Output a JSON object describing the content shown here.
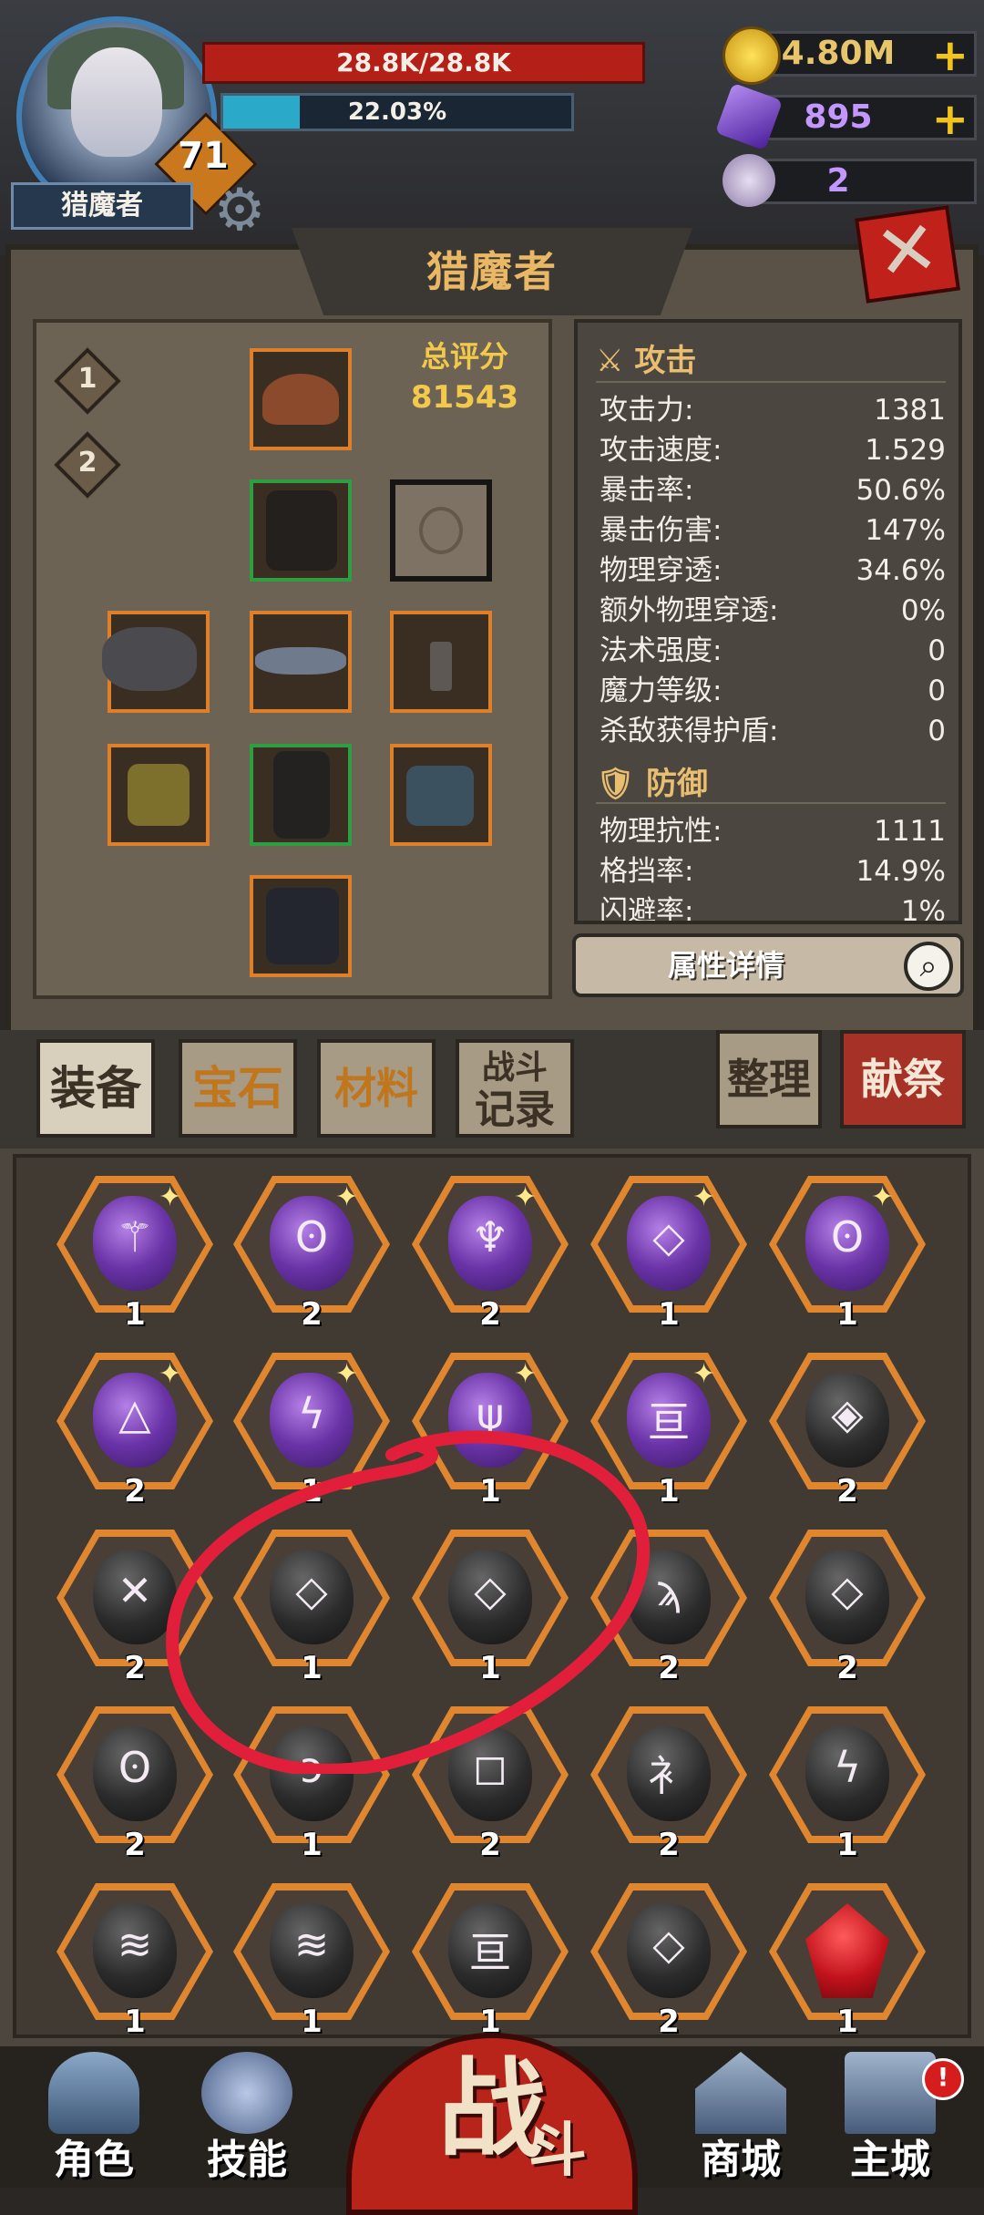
{
  "player": {
    "name": "猎魔者",
    "level": "71",
    "hp_text": "28.8K/28.8K",
    "xp_text": "22.03%",
    "xp_progress": 0.2203
  },
  "currencies": [
    {
      "icon": "gold-coin-icon",
      "value": "4.80M",
      "has_plus": true
    },
    {
      "icon": "purple-crystal-icon",
      "value": "895",
      "has_plus": true
    },
    {
      "icon": "ram-skull-icon",
      "value": "2",
      "has_plus": false
    }
  ],
  "panel": {
    "title": "猎魔者",
    "loadout_tabs": [
      "1",
      "2"
    ],
    "score_label": "总评分",
    "score_value": "81543"
  },
  "stats": {
    "attack_header": "攻击",
    "attack": [
      {
        "label": "攻击力:",
        "value": "1381"
      },
      {
        "label": "攻击速度:",
        "value": "1.529"
      },
      {
        "label": "暴击率:",
        "value": "50.6%"
      },
      {
        "label": "暴击伤害:",
        "value": "147%"
      },
      {
        "label": "物理穿透:",
        "value": "34.6%"
      },
      {
        "label": "额外物理穿透:",
        "value": "0%"
      },
      {
        "label": "法术强度:",
        "value": "0"
      },
      {
        "label": "魔力等级:",
        "value": "0"
      },
      {
        "label": "杀敌获得护盾:",
        "value": "0"
      }
    ],
    "defense_header": "防御",
    "defense": [
      {
        "label": "物理抗性:",
        "value": "1111"
      },
      {
        "label": "格挡率:",
        "value": "14.9%"
      },
      {
        "label": "闪避率:",
        "value": "1%"
      }
    ],
    "detail_button": "属性详情"
  },
  "tabs": {
    "equipment": "装备",
    "gems": "宝石",
    "materials": "材料",
    "battle_log_1": "战斗",
    "battle_log_2": "记录",
    "sort": "整理",
    "sacrifice": "献祭"
  },
  "colors": {
    "rarity_orange": "#e07f2a",
    "rarity_green": "#2e9f41",
    "hp_red": "#b41f18",
    "xp_cyan": "#2ba9c9",
    "gold_text": "#f3c94c"
  },
  "inventory": [
    {
      "type": "purple",
      "glyph": "⚚",
      "count": "1"
    },
    {
      "type": "purple",
      "glyph": "ʘ",
      "count": "2"
    },
    {
      "type": "purple",
      "glyph": "♆",
      "count": "2"
    },
    {
      "type": "purple",
      "glyph": "◇",
      "count": "1"
    },
    {
      "type": "purple",
      "glyph": "ʘ",
      "count": "1"
    },
    {
      "type": "purple",
      "glyph": "△",
      "count": "2"
    },
    {
      "type": "purple",
      "glyph": "ϟ",
      "count": "1"
    },
    {
      "type": "purple",
      "glyph": "ψ",
      "count": "1"
    },
    {
      "type": "purple",
      "glyph": "亘",
      "count": "1"
    },
    {
      "type": "black",
      "glyph": "◈",
      "count": "2"
    },
    {
      "type": "black",
      "glyph": "✕",
      "count": "2"
    },
    {
      "type": "black",
      "glyph": "◇",
      "count": "1"
    },
    {
      "type": "black",
      "glyph": "◇",
      "count": "1"
    },
    {
      "type": "black",
      "glyph": "ϡ",
      "count": "2"
    },
    {
      "type": "black",
      "glyph": "◇",
      "count": "2"
    },
    {
      "type": "black",
      "glyph": "ʘ",
      "count": "2"
    },
    {
      "type": "black",
      "glyph": "ᴐ",
      "count": "1"
    },
    {
      "type": "black",
      "glyph": "◻",
      "count": "2"
    },
    {
      "type": "black",
      "glyph": "衤",
      "count": "2"
    },
    {
      "type": "black",
      "glyph": "ϟ",
      "count": "1"
    },
    {
      "type": "black",
      "glyph": "≋",
      "count": "1"
    },
    {
      "type": "black",
      "glyph": "≋",
      "count": "1"
    },
    {
      "type": "black",
      "glyph": "亘",
      "count": "1"
    },
    {
      "type": "black",
      "glyph": "◇",
      "count": "2"
    },
    {
      "type": "red",
      "glyph": "",
      "count": "1"
    }
  ],
  "bottom_nav": {
    "character": "角色",
    "skills": "技能",
    "battle_main": "战",
    "battle_sub": "斗",
    "shop": "商城",
    "main_city": "主城",
    "main_city_alert": "!"
  }
}
